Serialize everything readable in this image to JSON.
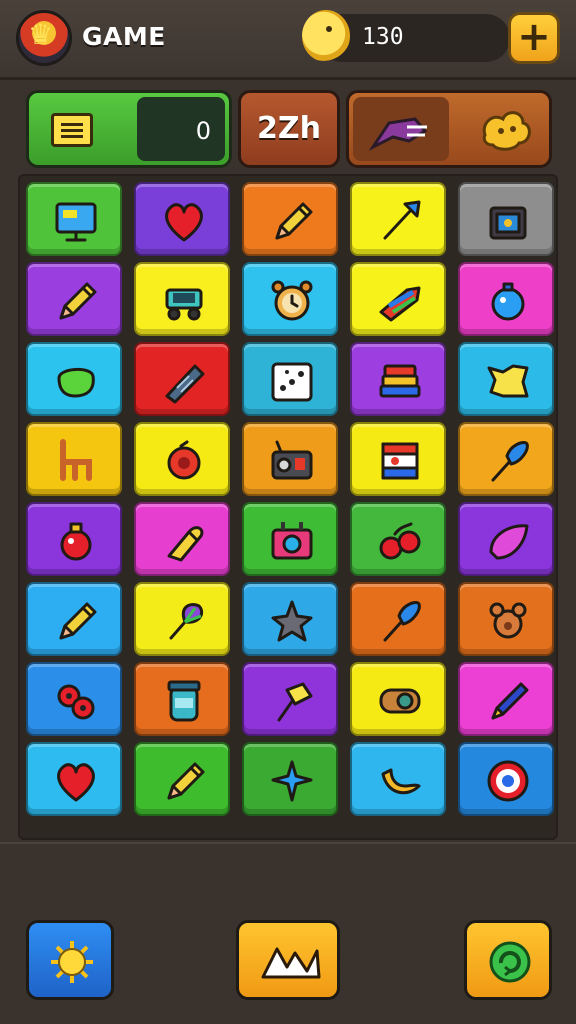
{
  "header": {
    "title": "GAME",
    "coins": "130",
    "add_label": "+"
  },
  "stats": {
    "score": "0",
    "timer": "2Zh"
  },
  "board": {
    "rows": 8,
    "cols": 5,
    "tiles": [
      {
        "color": "#4fc43a",
        "icon": "monitor-icon"
      },
      {
        "color": "#7b3fd9",
        "icon": "heart-icon"
      },
      {
        "color": "#ef7a1e",
        "icon": "pencil-icon"
      },
      {
        "color": "#f7f21a",
        "icon": "arrow-icon"
      },
      {
        "color": "#8e8e8e",
        "icon": "treasure-chest-icon"
      },
      {
        "color": "#9a3ee0",
        "icon": "pencil-icon"
      },
      {
        "color": "#f9ee1e",
        "icon": "cart-icon"
      },
      {
        "color": "#2fc2ee",
        "icon": "alarm-clock-icon"
      },
      {
        "color": "#f7f21a",
        "icon": "crayon-icon"
      },
      {
        "color": "#ee3fc9",
        "icon": "ornament-icon"
      },
      {
        "color": "#2cc3ef",
        "icon": "soap-icon"
      },
      {
        "color": "#e32424",
        "icon": "tube-icon"
      },
      {
        "color": "#2eb3d6",
        "icon": "dice-icon"
      },
      {
        "color": "#9d3ee0",
        "icon": "books-icon"
      },
      {
        "color": "#2cbbe8",
        "icon": "cheese-icon"
      },
      {
        "color": "#f5c60f",
        "icon": "chair-icon"
      },
      {
        "color": "#f5ea14",
        "icon": "bell-icon"
      },
      {
        "color": "#ef9c1b",
        "icon": "radio-icon"
      },
      {
        "color": "#f5ea14",
        "icon": "flag-icon"
      },
      {
        "color": "#f2a61c",
        "icon": "brush-icon"
      },
      {
        "color": "#8a36dc",
        "icon": "potion-icon"
      },
      {
        "color": "#e63fd0",
        "icon": "bullet-icon"
      },
      {
        "color": "#3fbc36",
        "icon": "camera-icon"
      },
      {
        "color": "#43b83c",
        "icon": "cherries-icon"
      },
      {
        "color": "#8a36dc",
        "icon": "leaf-icon"
      },
      {
        "color": "#2eaef2",
        "icon": "pencil-icon"
      },
      {
        "color": "#f4ec18",
        "icon": "fan-icon"
      },
      {
        "color": "#2ea8e6",
        "icon": "star-icon"
      },
      {
        "color": "#e66f1c",
        "icon": "brush-icon"
      },
      {
        "color": "#e2701c",
        "icon": "bear-icon"
      },
      {
        "color": "#2b8ee8",
        "icon": "eyes-icon"
      },
      {
        "color": "#e66d1e",
        "icon": "jar-icon"
      },
      {
        "color": "#8e34da",
        "icon": "hammer-icon"
      },
      {
        "color": "#f5ea14",
        "icon": "bandage-icon"
      },
      {
        "color": "#ec3fd3",
        "icon": "pen-icon"
      },
      {
        "color": "#2ebbef",
        "icon": "heart-icon"
      },
      {
        "color": "#3fbc2e",
        "icon": "pencil-icon"
      },
      {
        "color": "#3aaa32",
        "icon": "sparkle-icon"
      },
      {
        "color": "#2fb6ee",
        "icon": "banana-icon"
      },
      {
        "color": "#2488de",
        "icon": "target-icon"
      }
    ]
  },
  "footer": {
    "left_button": "sun-icon",
    "middle_button": "mountain-icon",
    "right_button": "refresh-icon"
  }
}
